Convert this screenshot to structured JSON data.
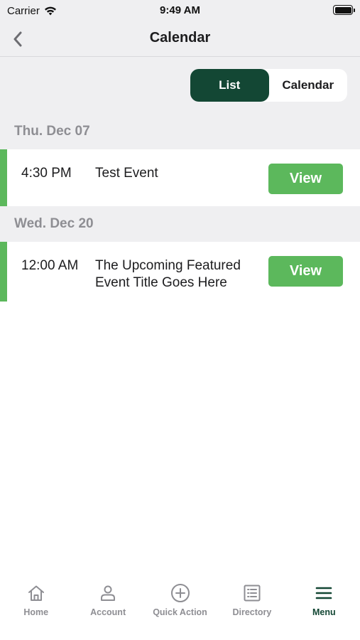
{
  "status_bar": {
    "carrier": "Carrier",
    "time": "9:49 AM"
  },
  "nav": {
    "title": "Calendar"
  },
  "view_toggle": {
    "list_label": "List",
    "calendar_label": "Calendar",
    "selected": "List"
  },
  "events": [
    {
      "date": "Thu. Dec 07",
      "items": [
        {
          "time": "4:30 PM",
          "title": "Test Event",
          "action": "View"
        }
      ]
    },
    {
      "date": "Wed. Dec 20",
      "items": [
        {
          "time": "12:00 AM",
          "title": "The Upcoming Featured Event Title Goes Here",
          "action": "View"
        }
      ]
    }
  ],
  "tab_bar": {
    "items": [
      {
        "label": "Home",
        "icon": "home-icon"
      },
      {
        "label": "Account",
        "icon": "person-icon"
      },
      {
        "label": "Quick Action",
        "icon": "plus-circle-icon"
      },
      {
        "label": "Directory",
        "icon": "list-icon"
      },
      {
        "label": "Menu",
        "icon": "hamburger-menu-icon"
      }
    ],
    "active": "Menu"
  },
  "colors": {
    "accent_dark": "#134734",
    "accent_green": "#5cb85c",
    "muted": "#8e8e93",
    "background": "#efeff1"
  }
}
